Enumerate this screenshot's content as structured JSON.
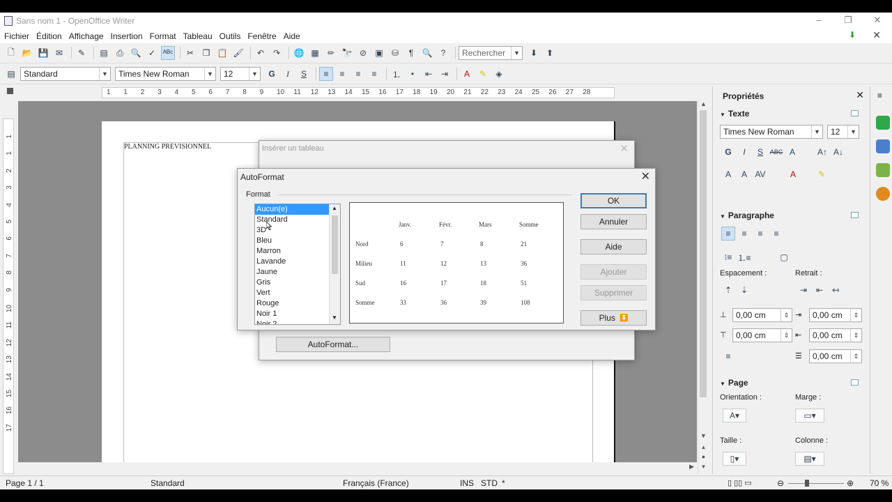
{
  "window": {
    "title": "Sans nom 1 - OpenOffice Writer",
    "minimize": "–",
    "restore": "❐",
    "close": "✕"
  },
  "menu": [
    "Fichier",
    "Édition",
    "Affichage",
    "Insertion",
    "Format",
    "Tableau",
    "Outils",
    "Fenêtre",
    "Aide"
  ],
  "toolbar": {
    "search_placeholder": "Rechercher",
    "style": "Standard",
    "font": "Times New Roman",
    "size": "12",
    "bold": "G",
    "italic": "I",
    "underline": "S"
  },
  "ruler_h": [
    "1",
    "1",
    "2",
    "3",
    "4",
    "5",
    "6",
    "7",
    "8",
    "9",
    "10",
    "11",
    "12",
    "13",
    "14",
    "15",
    "16",
    "17",
    "18",
    "19",
    "20",
    "21",
    "22",
    "23",
    "24",
    "25",
    "26",
    "27",
    "28"
  ],
  "ruler_v": [
    "1",
    "1",
    "2",
    "3",
    "4",
    "5",
    "6",
    "7",
    "8",
    "9",
    "10",
    "11",
    "12",
    "13",
    "14",
    "15",
    "16",
    "17"
  ],
  "document": {
    "text": "PLANNING PREVISIONNEL"
  },
  "dialog_insert": {
    "title": "Insérer un tableau",
    "autoformat_button": "AutoFormat..."
  },
  "dialog_autoformat": {
    "title": "AutoFormat",
    "format_label": "Format",
    "formats": [
      "Aucun(e)",
      "Standard",
      "3D",
      "Bleu",
      "Marron",
      "Lavande",
      "Jaune",
      "Gris",
      "Vert",
      "Rouge",
      "Noir 1",
      "Noir 2"
    ],
    "selected": "Aucun(e)",
    "preview": {
      "headers": [
        "Janv.",
        "Févr.",
        "Mars",
        "Somme"
      ],
      "rows": [
        {
          "label": "Nord",
          "values": [
            "6",
            "7",
            "8",
            "21"
          ]
        },
        {
          "label": "Milieu",
          "values": [
            "11",
            "12",
            "13",
            "36"
          ]
        },
        {
          "label": "Sud",
          "values": [
            "16",
            "17",
            "18",
            "51"
          ]
        },
        {
          "label": "Somme",
          "values": [
            "33",
            "36",
            "39",
            "108"
          ]
        }
      ]
    },
    "buttons": {
      "ok": "OK",
      "cancel": "Annuler",
      "help": "Aide",
      "add": "Ajouter",
      "delete": "Supprimer",
      "more": "Plus"
    }
  },
  "sidebar": {
    "title": "Propriétés",
    "close": "✕",
    "text_section": "Texte",
    "font": "Times New Roman",
    "size": "12",
    "paragraph_section": "Paragraphe",
    "spacing_label": "Espacement :",
    "indent_label": "Retrait :",
    "spin_values": [
      "0,00 cm",
      "0,00 cm",
      "0,00 cm",
      "0,00 cm",
      "0,00 cm"
    ],
    "page_section": "Page",
    "orientation_label": "Orientation :",
    "margin_label": "Marge :",
    "size_label": "Taille :",
    "columns_label": "Colonne :"
  },
  "status": {
    "page": "Page 1 / 1",
    "style": "Standard",
    "language": "Français (France)",
    "ins": "INS",
    "std": "STD",
    "modified": "*",
    "zoom": "70 %"
  }
}
